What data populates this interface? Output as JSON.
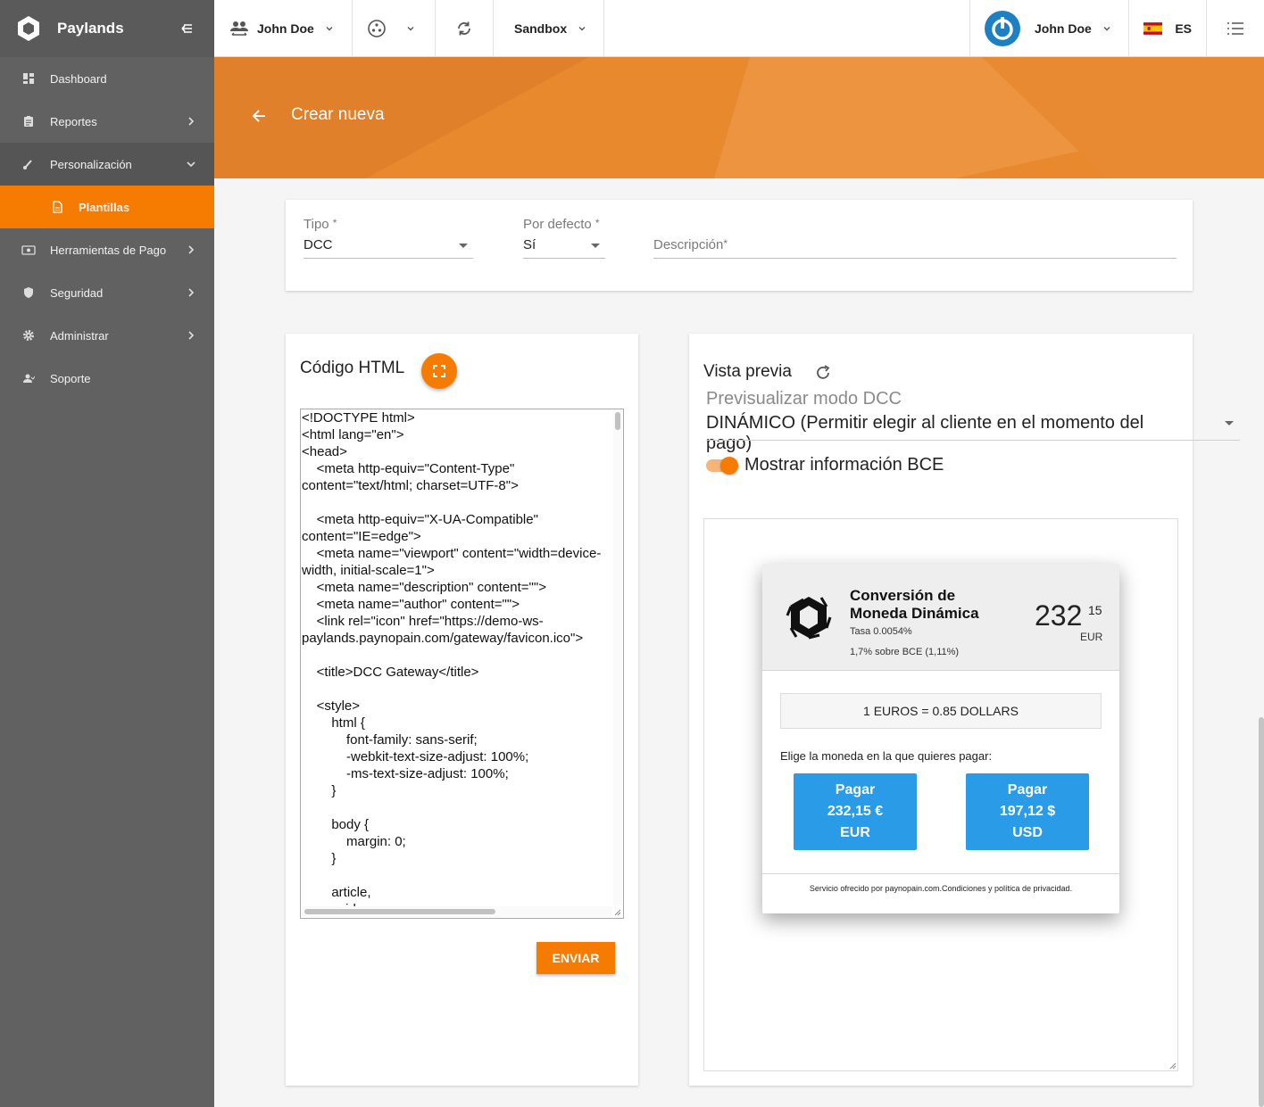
{
  "app": {
    "brand": "Paylands"
  },
  "sidebar": {
    "items": [
      {
        "label": "Dashboard",
        "icon": "dashboard-icon"
      },
      {
        "label": "Reportes",
        "icon": "clipboard-icon"
      },
      {
        "label": "Personalización",
        "icon": "brush-icon"
      },
      {
        "label": "Plantillas",
        "icon": "file-icon"
      },
      {
        "label": "Herramientas de Pago",
        "icon": "payment-icon"
      },
      {
        "label": "Seguridad",
        "icon": "shield-icon"
      },
      {
        "label": "Administrar",
        "icon": "gear-icon"
      },
      {
        "label": "Soporte",
        "icon": "support-icon"
      }
    ]
  },
  "topbar": {
    "account": "John Doe",
    "environment": "Sandbox",
    "user": "John Doe",
    "language": "ES"
  },
  "header": {
    "title": "Crear nueva"
  },
  "form": {
    "tipo": {
      "label": "Tipo",
      "value": "DCC"
    },
    "por_defecto": {
      "label": "Por defecto",
      "value": "Sí"
    },
    "descripcion": {
      "label": "Descripción",
      "value": ""
    },
    "required_mark": "*"
  },
  "code": {
    "title": "Código HTML",
    "content": "<!DOCTYPE html>\n<html lang=\"en\">\n<head>\n    <meta http-equiv=\"Content-Type\" content=\"text/html; charset=UTF-8\">\n\n    <meta http-equiv=\"X-UA-Compatible\" content=\"IE=edge\">\n    <meta name=\"viewport\" content=\"width=device-width, initial-scale=1\">\n    <meta name=\"description\" content=\"\">\n    <meta name=\"author\" content=\"\">\n    <link rel=\"icon\" href=\"https://demo-ws-paylands.paynopain.com/gateway/favicon.ico\">\n\n    <title>DCC Gateway</title>\n\n    <style>\n        html {\n            font-family: sans-serif;\n            -webkit-text-size-adjust: 100%;\n            -ms-text-size-adjust: 100%;\n        }\n\n        body {\n            margin: 0;\n        }\n\n        article,\n        aside,",
    "submit": "ENVIAR"
  },
  "preview": {
    "title": "Vista previa",
    "mode_label": "Previsualizar modo DCC",
    "mode_value": "DINÁMICO (Permitir elegir al cliente en el momento del pago)",
    "toggle_label": "Mostrar información BCE",
    "toggle_on": true,
    "dcc": {
      "title": "Conversión de Moneda Dinámica",
      "rate": "Tasa 0.0054%",
      "markup": "1,7% sobre BCE (1,11%)",
      "amount_int": "232",
      "amount_dec": "15",
      "currency": "EUR",
      "exchange": "1 EUROS = 0.85 DOLLARS",
      "choose": "Elige la moneda en la que quieres pagar:",
      "pay_eur": {
        "line1": "Pagar",
        "line2": "232,15 €",
        "line3": "EUR"
      },
      "pay_usd": {
        "line1": "Pagar",
        "line2": "197,12 $",
        "line3": "USD"
      },
      "footer": "Servicio ofrecido por paynopain.com.Condiciones y política de privacidad."
    }
  },
  "colors": {
    "accent": "#f57c00",
    "sidebar": "#616161",
    "hero": "#e8892d",
    "pay_button": "#2a9be6"
  }
}
